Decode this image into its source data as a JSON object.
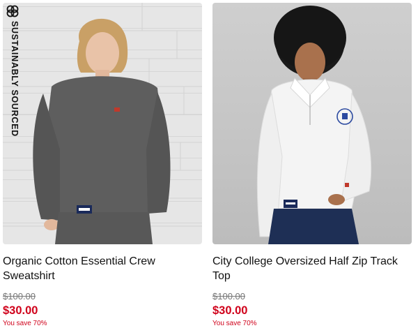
{
  "products": [
    {
      "badge": "SUSTAINABLY SOURCED",
      "badge_icon": "sustainability-logo-icon",
      "title": "Organic Cotton Essential Crew Sweatshirt",
      "price_original": "$100.00",
      "price_sale": "$30.00",
      "savings": "You save 70%",
      "image": "grey-crew-sweatshirt-photo"
    },
    {
      "title": "City College Oversized Half Zip Track Top",
      "price_original": "$100.00",
      "price_sale": "$30.00",
      "savings": "You save 70%",
      "image": "white-half-zip-track-top-photo"
    }
  ],
  "colors": {
    "sale_red": "#d0021b",
    "original_price_grey": "#777777",
    "text": "#111111"
  }
}
